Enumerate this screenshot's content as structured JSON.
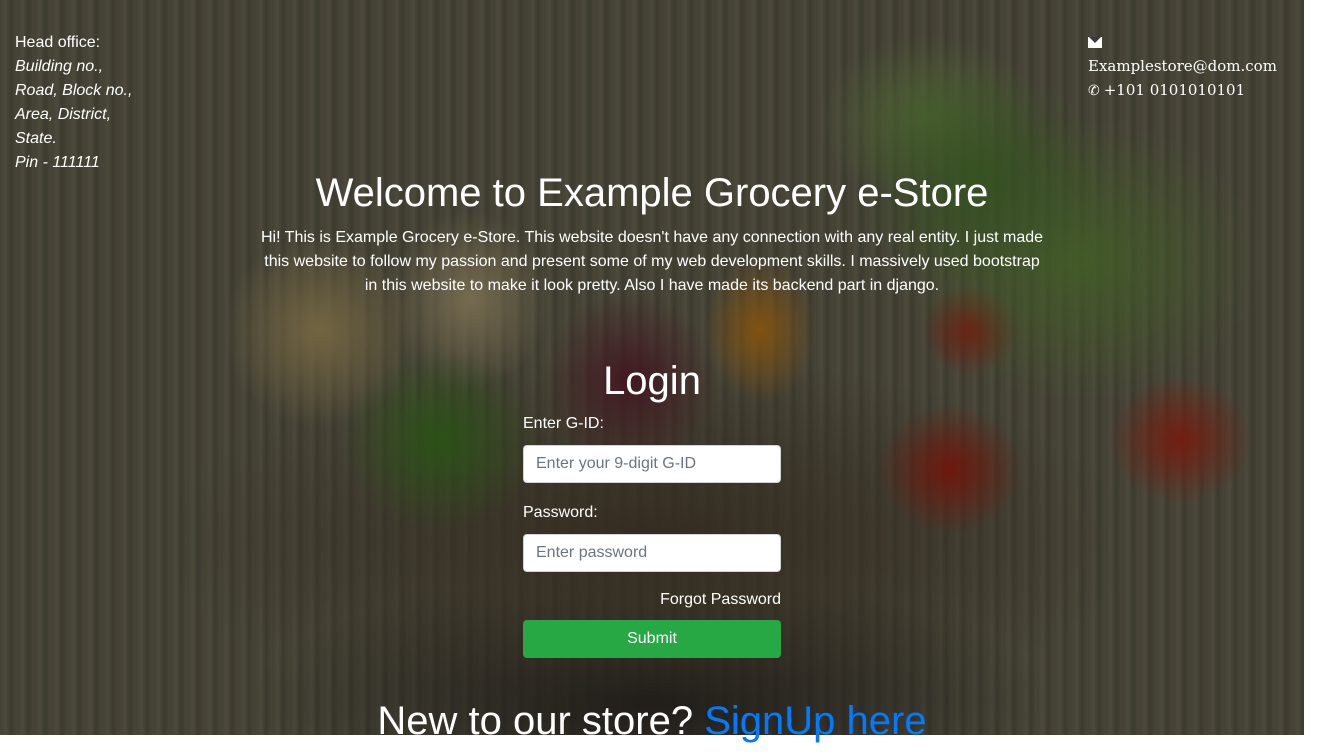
{
  "office": {
    "heading": "Head office:",
    "lines": [
      "Building no.,",
      "Road, Block no.,",
      "Area, District,",
      "State.",
      "Pin - 111111"
    ]
  },
  "contact": {
    "email_icon": "envelope-icon",
    "email": "Examplestore@dom.com",
    "phone_icon": "phone-icon",
    "phone": "+101 0101010101"
  },
  "hero": {
    "title": "Welcome to Example Grocery e-Store",
    "description": "Hi! This is Example Grocery e-Store. This website doesn't have any connection with any real entity. I just made this website to follow my passion and present some of my web development skills. I massively used bootstrap in this website to make it look pretty. Also I have made its backend part in django."
  },
  "login": {
    "title": "Login",
    "gid_label": "Enter G-ID:",
    "gid_placeholder": "Enter your 9-digit G-ID",
    "password_label": "Password:",
    "password_placeholder": "Enter password",
    "forgot_label": "Forgot Password",
    "submit_label": "Submit"
  },
  "signup": {
    "prompt": "New to our store? ",
    "link_label": "SignUp here"
  },
  "colors": {
    "submit": "#28a745",
    "link": "#007bff"
  }
}
